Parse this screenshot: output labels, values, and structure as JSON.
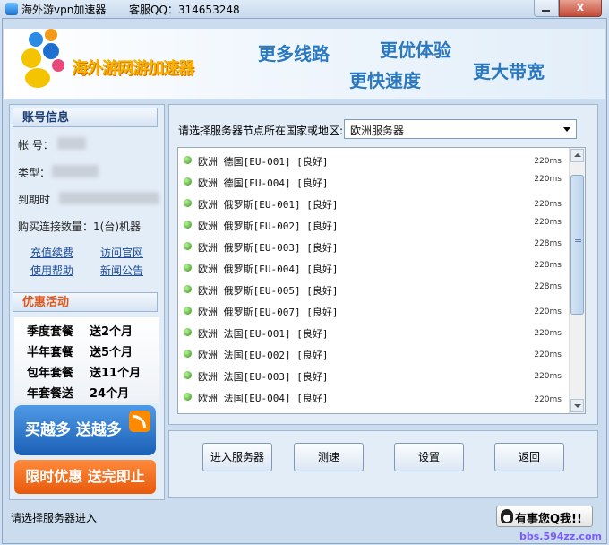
{
  "window": {
    "title": "海外游vpn加速器",
    "qq_contact": "客服QQ：314653248",
    "close_glyph": "x"
  },
  "banner": {
    "logo_text": "海外游网游加速器",
    "slogans": [
      "更多线路",
      "更优体验",
      "更快速度",
      "更大带宽"
    ]
  },
  "account": {
    "heading": "账号信息",
    "account_label": "帐 号：",
    "type_label": "类型：",
    "expiry_label": "到期时",
    "connections": "购买连接数量：1(台)机器",
    "links": [
      "充值续费",
      "访问官网",
      "使用帮助",
      "新闻公告"
    ]
  },
  "promo": {
    "heading": "优惠活动",
    "rows": [
      {
        "plan": "季度套餐",
        "bonus": "送2个月"
      },
      {
        "plan": "半年套餐",
        "bonus": "送5个月"
      },
      {
        "plan": "包年套餐",
        "bonus": "送11个月"
      },
      {
        "plan": "年套餐送",
        "bonus": "24个月"
      }
    ],
    "banner1": "买越多 送越多",
    "banner2": "限时优惠 送完即止"
  },
  "servers": {
    "region_label": "请选择服务器节点所在国家或地区:",
    "region_selected": "欧洲服务器",
    "list": [
      {
        "name": "欧洲 德国[EU-001] [良好]",
        "ping": "220ms"
      },
      {
        "name": "欧洲 德国[EU-004] [良好]",
        "ping": "220ms"
      },
      {
        "name": "欧洲 俄罗斯[EU-001] [良好]",
        "ping": "220ms"
      },
      {
        "name": "欧洲 俄罗斯[EU-002] [良好]",
        "ping": "220ms"
      },
      {
        "name": "欧洲 俄罗斯[EU-003] [良好]",
        "ping": "228ms"
      },
      {
        "name": "欧洲 俄罗斯[EU-004] [良好]",
        "ping": "228ms"
      },
      {
        "name": "欧洲 俄罗斯[EU-005] [良好]",
        "ping": "228ms"
      },
      {
        "name": "欧洲 俄罗斯[EU-007] [良好]",
        "ping": "220ms"
      },
      {
        "name": "欧洲 法国[EU-001] [良好]",
        "ping": "220ms"
      },
      {
        "name": "欧洲 法国[EU-002] [良好]",
        "ping": "220ms"
      },
      {
        "name": "欧洲 法国[EU-003] [良好]",
        "ping": "220ms"
      },
      {
        "name": "欧洲 法国[EU-004] [良好]",
        "ping": "220ms"
      }
    ]
  },
  "buttons": {
    "enter": "进入服务器",
    "speedtest": "测速",
    "settings": "设置",
    "back": "返回"
  },
  "status": {
    "text": "请选择服务器进入",
    "qq_button": "有事您Q我!!"
  },
  "watermark": "bbs.594zz.com"
}
